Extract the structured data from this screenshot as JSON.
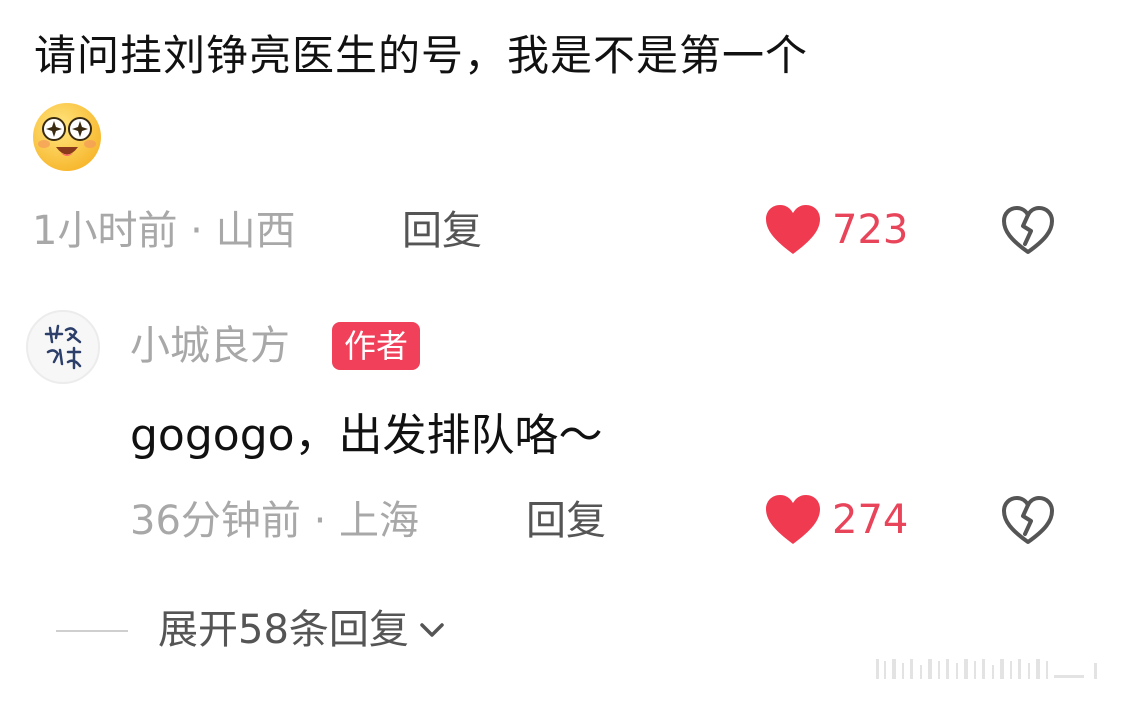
{
  "comment": {
    "text": "请问挂刘铮亮医生的号，我是不是第一个",
    "emoji": "starry-eyed-face-icon",
    "time": "1小时前 · 山西",
    "reply_label": "回复",
    "likes": "723"
  },
  "reply": {
    "author": "小城良方",
    "badge": "作者",
    "text": "gogogo，出发排队咯～",
    "time": "36分钟前 · 上海",
    "reply_label": "回复",
    "likes": "274"
  },
  "expand": {
    "label": "展开58条回复"
  },
  "colors": {
    "like": "#e8445a",
    "badge": "#f0405a",
    "meta": "#a8a8a8"
  }
}
